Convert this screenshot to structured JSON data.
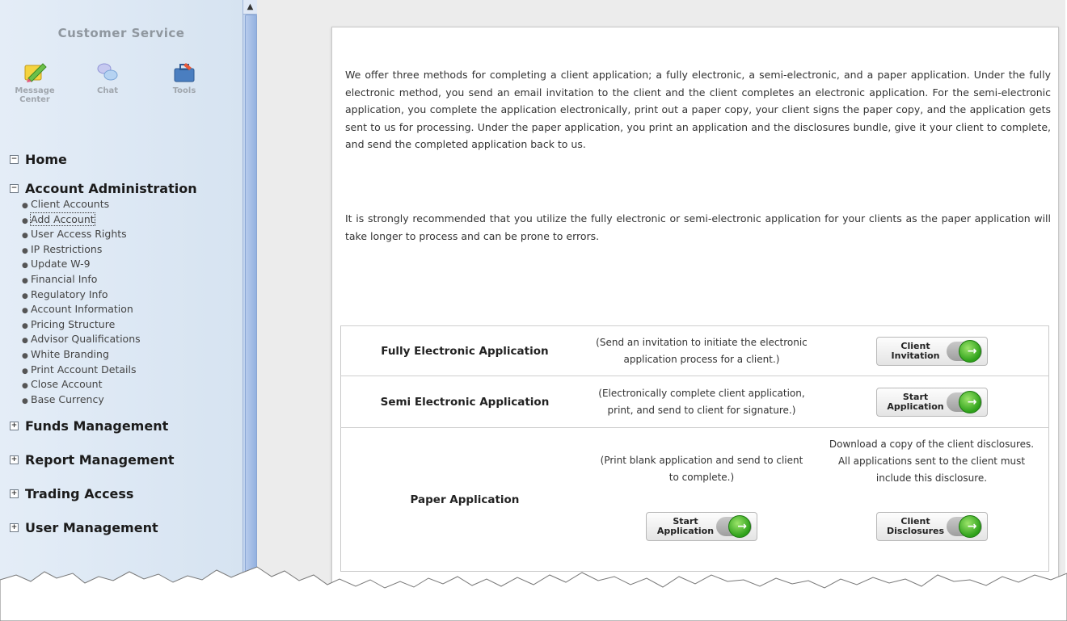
{
  "sidebar": {
    "title": "Customer Service",
    "tools": [
      {
        "label": "Message Center",
        "icon": "pencil-note-icon"
      },
      {
        "label": "Chat",
        "icon": "chat-bubbles-icon"
      },
      {
        "label": "Tools",
        "icon": "toolbox-icon"
      }
    ],
    "sections": [
      {
        "label": "Home",
        "toggle": "⊟",
        "expanded": true,
        "items": []
      },
      {
        "label": "Account Administration",
        "toggle": "⊟",
        "expanded": true,
        "items": [
          "Client Accounts",
          "Add Account",
          "User Access Rights",
          "IP Restrictions",
          "Update W-9",
          "Financial Info",
          "Regulatory Info",
          "Account Information",
          "Pricing Structure",
          "Advisor Qualifications",
          "White Branding",
          "Print Account Details",
          "Close Account",
          "Base Currency"
        ]
      },
      {
        "label": "Funds Management",
        "toggle": "⊞",
        "expanded": false,
        "items": []
      },
      {
        "label": "Report Management",
        "toggle": "⊞",
        "expanded": false,
        "items": []
      },
      {
        "label": "Trading Access",
        "toggle": "⊞",
        "expanded": false,
        "items": []
      },
      {
        "label": "User Management",
        "toggle": "⊞",
        "expanded": false,
        "items": []
      }
    ]
  },
  "main": {
    "paragraph1": "We offer three methods for completing a client application; a fully electronic, a semi-electronic, and a paper application. Under the fully electronic method, you send an email invitation to the client and the client completes an electronic application. For the semi-electronic application, you complete the application electronically, print out a paper copy, your client signs the paper copy, and the application gets sent to us for processing. Under the paper application, you print an application and the disclosures bundle, give it your client to complete, and send the completed application back to us.",
    "paragraph2": "It is strongly recommended that you utilize the fully electronic or semi-electronic application for your clients as the paper application will take longer to process and can be prone to errors.",
    "applications": {
      "fully": {
        "name": "Fully Electronic Application",
        "desc": "(Send an invitation to initiate the electronic application process for a client.)",
        "button_line1": "Client",
        "button_line2": "Invitation"
      },
      "semi": {
        "name": "Semi Electronic Application",
        "desc": "(Electronically complete client application, print, and send to client for signature.)",
        "button_line1": "Start",
        "button_line2": "Application"
      },
      "paper": {
        "name": "Paper Application",
        "desc": "(Print blank application and send to client to complete.)",
        "disclosure_desc": "Download a copy of the client disclosures. All applications sent to the client must include this disclosure.",
        "button1_line1": "Start",
        "button1_line2": "Application",
        "button2_line1": "Client",
        "button2_line2": "Disclosures"
      }
    }
  },
  "colors": {
    "sidebar_bg": "#dde8f4",
    "go_green": "#2ea11a"
  }
}
